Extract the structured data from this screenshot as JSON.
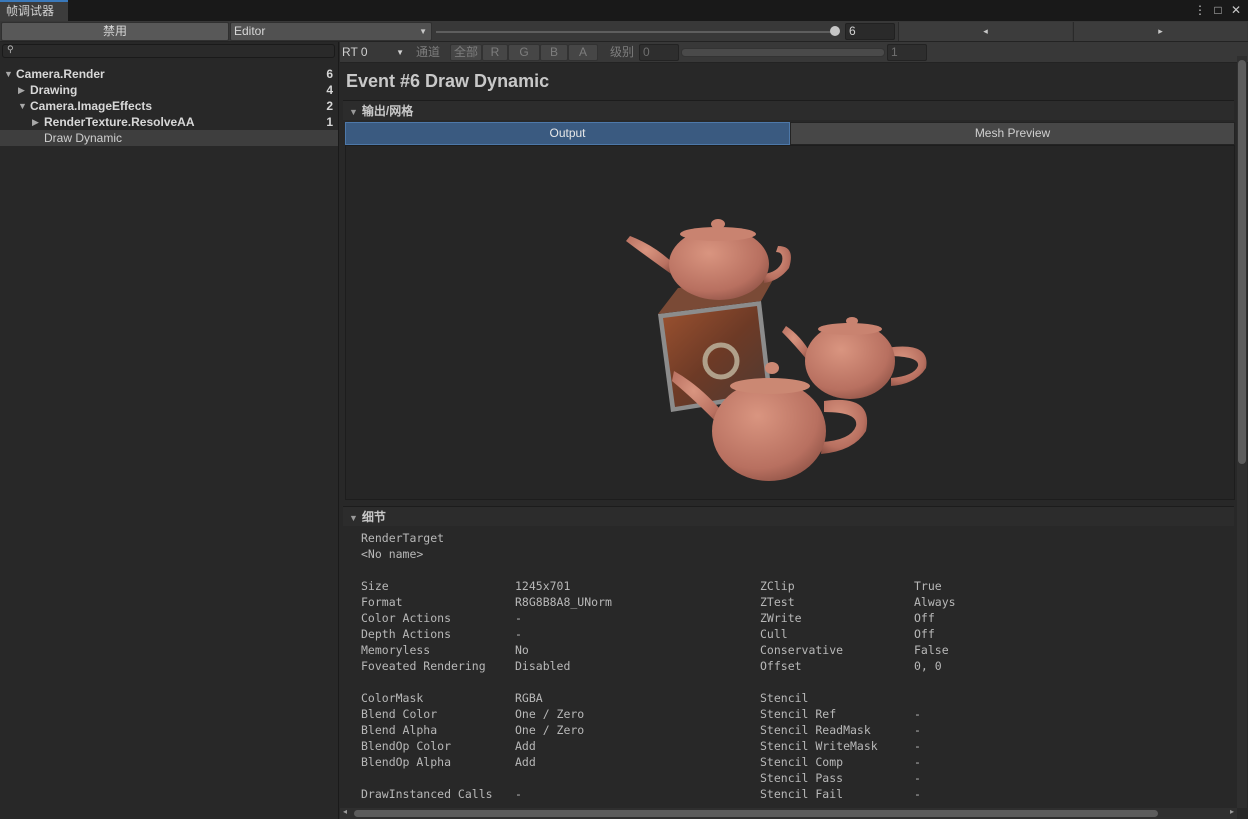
{
  "window": {
    "tab_title": "帧调试器",
    "controls": {
      "menu": "⋮",
      "maximize": "□",
      "close": "✕"
    }
  },
  "toolbar": {
    "disable_label": "禁用",
    "target_dropdown": "Editor",
    "event_number": "6",
    "prev_arrow": "◂",
    "next_arrow": "▸"
  },
  "hierarchy": {
    "search_placeholder": "",
    "items": [
      {
        "label": "Camera.Render",
        "count": "6",
        "depth": 0,
        "expanded": true,
        "bold": true
      },
      {
        "label": "Drawing",
        "count": "4",
        "depth": 1,
        "expanded": false,
        "bold": true
      },
      {
        "label": "Camera.ImageEffects",
        "count": "2",
        "depth": 1,
        "expanded": true,
        "bold": true
      },
      {
        "label": "RenderTexture.ResolveAA",
        "count": "1",
        "depth": 2,
        "expanded": false,
        "bold": true
      },
      {
        "label": "Draw Dynamic",
        "count": "",
        "depth": 2,
        "leaf": true,
        "selected": true
      }
    ]
  },
  "event_toolbar": {
    "render_target": "RT 0",
    "channels_label": "通道",
    "channels": [
      "全部",
      "R",
      "G",
      "B",
      "A"
    ],
    "level_label": "级别",
    "level_min": "0",
    "level_max": "1"
  },
  "event": {
    "title": "Event #6 Draw Dynamic",
    "output_section": "输出/网格",
    "tabs": [
      "Output",
      "Mesh Preview"
    ],
    "details_section": "细节",
    "render_target_label": "RenderTarget",
    "render_target_name": "<No name>",
    "left_props": [
      {
        "key": "Size",
        "value": "1245x701"
      },
      {
        "key": "Format",
        "value": "R8G8B8A8_UNorm"
      },
      {
        "key": "Color Actions",
        "value": "-"
      },
      {
        "key": "Depth Actions",
        "value": "-"
      },
      {
        "key": "Memoryless",
        "value": "No"
      },
      {
        "key": "Foveated Rendering",
        "value": "Disabled"
      },
      {
        "key": "",
        "value": ""
      },
      {
        "key": "ColorMask",
        "value": "RGBA"
      },
      {
        "key": "Blend Color",
        "value": "One / Zero"
      },
      {
        "key": "Blend Alpha",
        "value": "One / Zero"
      },
      {
        "key": "BlendOp Color",
        "value": "Add"
      },
      {
        "key": "BlendOp Alpha",
        "value": "Add"
      },
      {
        "key": "",
        "value": ""
      },
      {
        "key": "DrawInstanced Calls",
        "value": "-"
      }
    ],
    "right_props": [
      {
        "key": "ZClip",
        "value": "True"
      },
      {
        "key": "ZTest",
        "value": "Always"
      },
      {
        "key": "ZWrite",
        "value": "Off"
      },
      {
        "key": "Cull",
        "value": "Off"
      },
      {
        "key": "Conservative",
        "value": "False"
      },
      {
        "key": "Offset",
        "value": "0, 0"
      },
      {
        "key": "",
        "value": ""
      },
      {
        "key": "Stencil",
        "value": ""
      },
      {
        "key": "Stencil Ref",
        "value": "-"
      },
      {
        "key": "Stencil ReadMask",
        "value": "-"
      },
      {
        "key": "Stencil WriteMask",
        "value": "-"
      },
      {
        "key": "Stencil Comp",
        "value": "-"
      },
      {
        "key": "Stencil Pass",
        "value": "-"
      },
      {
        "key": "Stencil Fail",
        "value": "-"
      }
    ]
  },
  "colors": {
    "accent": "#3a79bb",
    "active_tab": "#3a5a80",
    "teapot": "#c57f68",
    "crate": "#8a4a2c"
  }
}
